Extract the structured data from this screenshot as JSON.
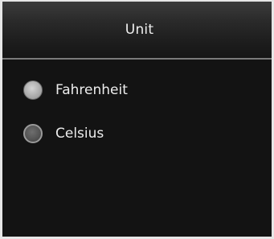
{
  "header": {
    "title": "Unit"
  },
  "options": [
    {
      "label": "Fahrenheit",
      "selected": true
    },
    {
      "label": "Celsius",
      "selected": false
    }
  ],
  "colors": {
    "background": "#131313",
    "header_bg": "#2a2a2a",
    "divider": "#7a7a7a",
    "text": "#ededed",
    "bezel": "#e6e6e6"
  },
  "icons": {
    "selected": "radio-selected-icon",
    "unselected": "radio-unselected-icon"
  }
}
